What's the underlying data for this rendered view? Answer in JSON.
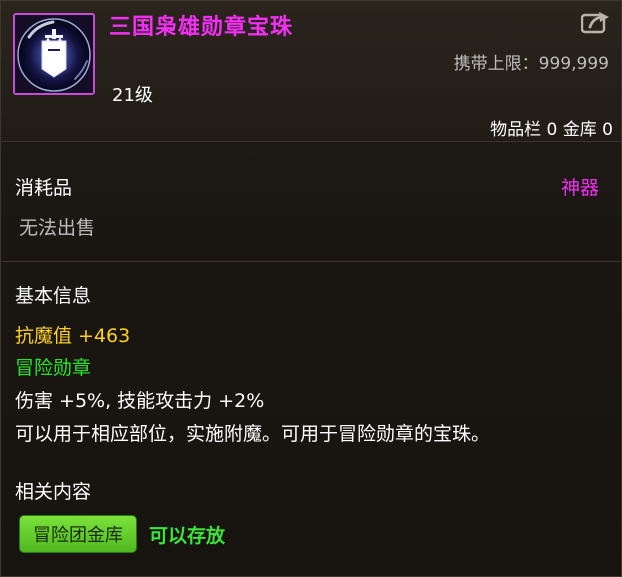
{
  "item": {
    "name": "三国枭雄勋章宝珠",
    "level": "21级",
    "icon": "shield-emblem-orb-icon"
  },
  "header": {
    "carry_limit": "携带上限：999,999",
    "storage": "物品栏 0 金库 0",
    "share_icon": "share-icon"
  },
  "category": {
    "type": "消耗品",
    "rarity": "神器",
    "sale": "无法出售"
  },
  "basic_info": {
    "title": "基本信息",
    "magic_resist": "抗魔值 +463",
    "badge_type": "冒险勋章",
    "effect": "伤害 +5%, 技能攻击力 +2%",
    "description": "可以用于相应部位，实施附魔。可用于冒险勋章的宝珠。"
  },
  "related": {
    "title": "相关内容",
    "tag_label": "冒险团金库",
    "tag_status": "可以存放"
  },
  "colors": {
    "name": "#f22ff2",
    "magic_resist": "#ffd11a",
    "badge_type": "#27e627",
    "tag_bg": "#5ccb2a"
  }
}
